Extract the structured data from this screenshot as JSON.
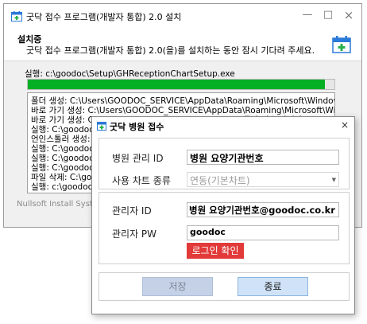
{
  "installer": {
    "title": "굿닥 접수 프로그램(개발자 통합) 2.0 설치",
    "header_title": "설치중",
    "header_subtitle": "굿닥 접수 프로그램(개발자 통합) 2.0(을)를 설치하는 동안 잠시 기다려 주세요.",
    "exec_line": "실행: c:\\goodoc\\Setup\\GHReceptionChartSetup.exe",
    "progress": 0.97,
    "log_lines": [
      "폴더 생성: C:\\Users\\GOODOC_SERVICE\\AppData\\Roaming\\Microsoft\\Windows\\...",
      "바로 가기 생성: C:\\Users\\GOODOC_SERVICE\\AppData\\Roaming\\Microsoft\\Win...",
      "바로 가기 생성: C:\\Users\\GOODOC_SERVICE\\Desktop\\굿닥 접수 관리자.lnk",
      "실행: C:\\goodoc\\",
      "언인스톨러 생성: c:\\",
      "실행: C:\\goodoc\\",
      "실행: C:\\goodoc\\",
      "실행: C:\\goodoc\\",
      "파일 삭제: C:\\good",
      "실행: c:\\goodoc\\"
    ],
    "footer": "Nullsoft Install System v",
    "colors": {
      "progress": "#06b025"
    }
  },
  "dialog": {
    "title": "굿닥 병원 접수",
    "hospital_id_label": "병원 관리 ID",
    "hospital_id_value": "병원 요양기관번호",
    "chart_type_label": "사용 차트 종류",
    "chart_type_value": "연동(기본차트)",
    "admin_id_label": "관리자 ID",
    "admin_id_value": "병원 요양기관번호@goodoc.co.kr",
    "admin_pw_label": "관리자 PW",
    "admin_pw_value": "goodoc",
    "login_button": "로그인 확인",
    "save_button": "저장",
    "end_button": "종료",
    "colors": {
      "login": "#e23a3a",
      "accent": "#2a7ad8"
    }
  }
}
